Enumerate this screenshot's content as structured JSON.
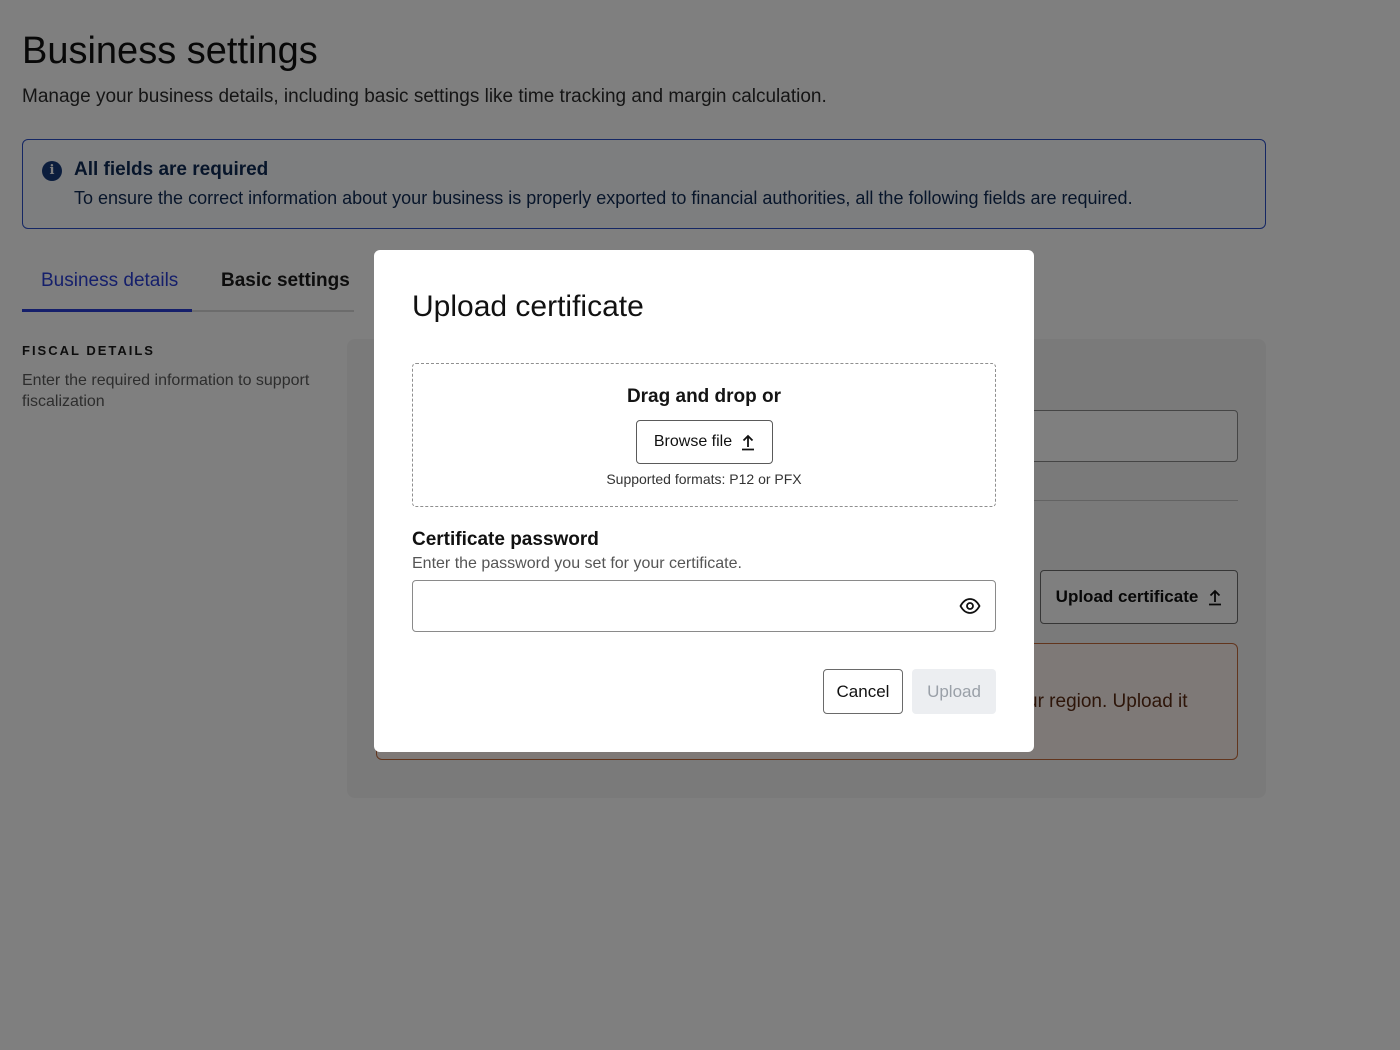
{
  "page": {
    "title": "Business settings",
    "subtitle": "Manage your business details, including basic settings like time tracking and margin calculation."
  },
  "notice": {
    "title": "All fields are required",
    "body": "To ensure the correct information about your business is properly exported to financial authorities, all the following fields are required.",
    "icon": "info-icon",
    "accent": "#2b4fc9"
  },
  "tabs": [
    {
      "label": "Business details",
      "active": true
    },
    {
      "label": "Basic settings",
      "active": false
    }
  ],
  "section": {
    "label": "FISCAL DETAILS",
    "description": "Enter the required information to support fiscalization"
  },
  "background_card": {
    "upload_button_label": "Upload certificate",
    "warning_text": "ur region. Upload it"
  },
  "modal": {
    "title": "Upload certificate",
    "dropzone": {
      "text": "Drag and drop or",
      "browse_label": "Browse file",
      "formats": "Supported formats: P12 or PFX"
    },
    "password": {
      "label": "Certificate password",
      "help": "Enter the password you set for your certificate.",
      "value": "",
      "placeholder": ""
    },
    "cancel_label": "Cancel",
    "upload_label": "Upload"
  },
  "colors": {
    "tab_active": "#2b3fd6",
    "overlay": "rgba(0,0,0,0.5)",
    "warning_border": "#c46a3a"
  }
}
